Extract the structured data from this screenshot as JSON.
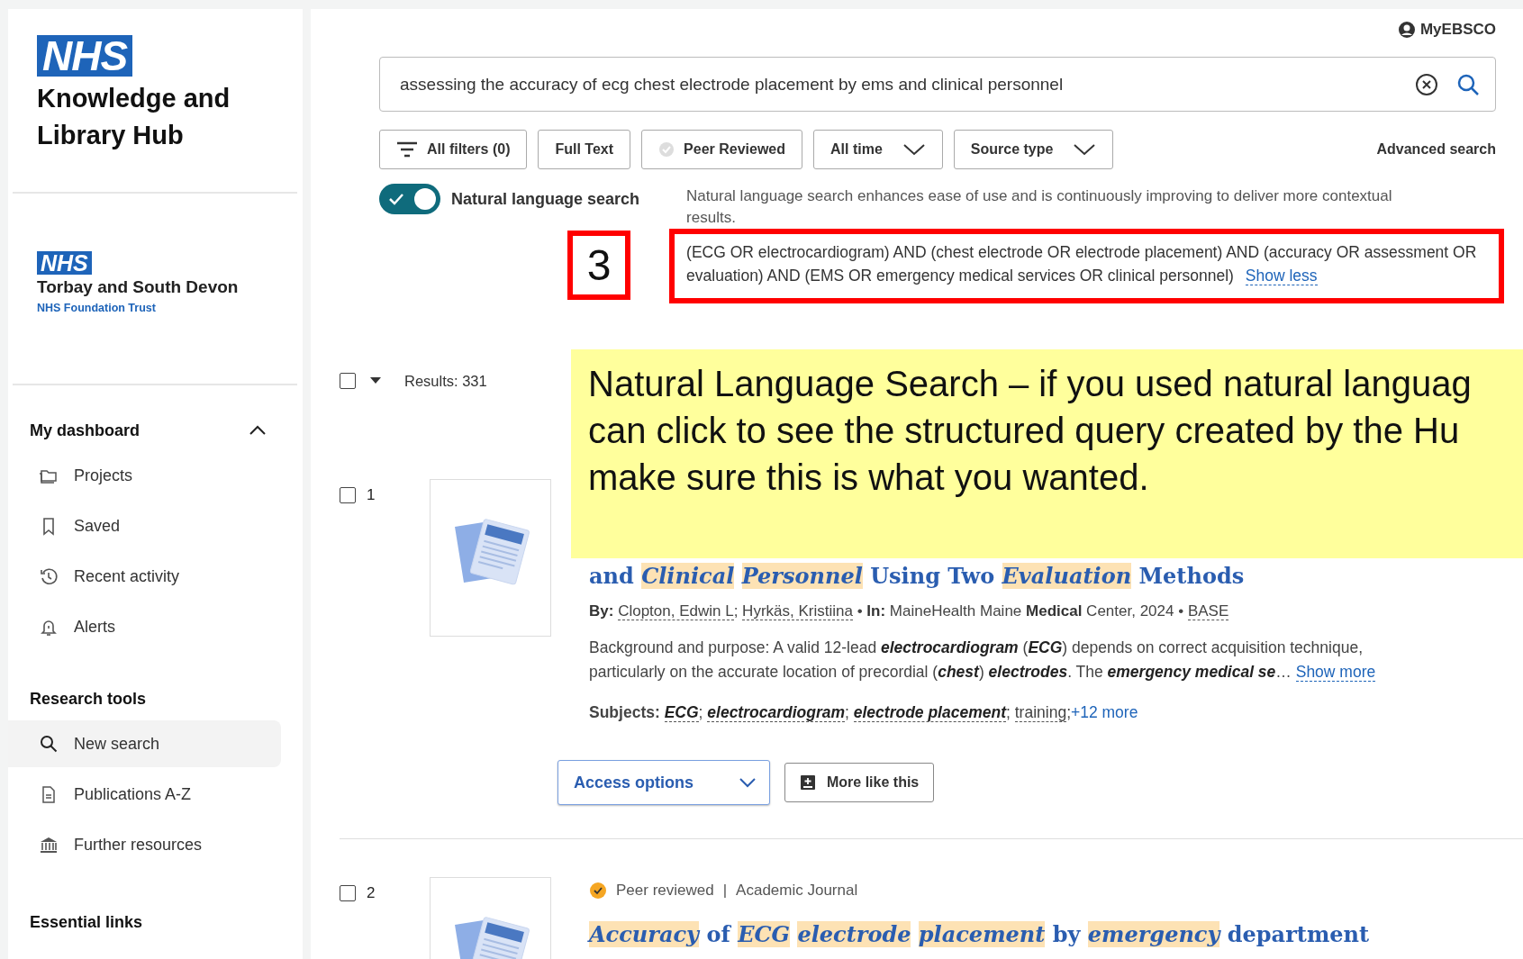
{
  "sidebar": {
    "logo": "NHS",
    "title": "Knowledge and Library Hub",
    "trust": {
      "logo": "NHS",
      "name": "Torbay and South Devon",
      "subtitle": "NHS Foundation Trust"
    },
    "sections": [
      {
        "heading": "My dashboard",
        "expanded": true,
        "items": [
          {
            "label": "Projects",
            "selected": false
          },
          {
            "label": "Saved",
            "selected": false
          },
          {
            "label": "Recent activity",
            "selected": false
          },
          {
            "label": "Alerts",
            "selected": false
          }
        ]
      },
      {
        "heading": "Research tools",
        "items": [
          {
            "label": "New search",
            "selected": true
          },
          {
            "label": "Publications A-Z",
            "selected": false
          },
          {
            "label": "Further resources",
            "selected": false
          }
        ]
      },
      {
        "heading": "Essential links"
      }
    ]
  },
  "account": {
    "label": "MyEBSCO"
  },
  "search": {
    "value": "assessing the accuracy of ecg chest electrode placement by ems and clinical personnel"
  },
  "filters": [
    {
      "label": "All filters (0)",
      "kind": "filters"
    },
    {
      "label": "Full Text",
      "kind": "plain"
    },
    {
      "label": "Peer Reviewed",
      "kind": "check",
      "checked": false
    },
    {
      "label": "All time",
      "kind": "dropdown"
    },
    {
      "label": "Source type",
      "kind": "dropdown"
    }
  ],
  "advanced_search": "Advanced search",
  "natural_language": {
    "label": "Natural language search",
    "on": true,
    "description": "Natural language search enhances ease of use and is continuously improving to deliver more contextual results.",
    "query": "(ECG OR electrocardiogram) AND (chest electrode OR electrode placement) AND (accuracy OR assessment OR evaluation) AND (EMS OR emergency medical services OR clinical personnel)",
    "toggle_link": "Show less"
  },
  "results_summary": {
    "label": "Results: 331",
    "checked": false
  },
  "results": [
    {
      "number": "1",
      "checked": false,
      "title": [
        {
          "text": "and",
          "highlighted": false
        },
        {
          "text": "Clinical",
          "highlighted": true
        },
        {
          "text": "Personnel",
          "highlighted": true
        },
        {
          "text": "Using Two",
          "highlighted": false
        },
        {
          "text": "Evaluation",
          "highlighted": true
        },
        {
          "text": "Methods",
          "highlighted": false
        }
      ],
      "byline": {
        "by_label": "By:",
        "authors": [
          "Clopton, Edwin L",
          "Hyrkäs, Kristiina"
        ],
        "author_separator": ";",
        "bullet": "•",
        "in_label": "In:",
        "source": "MaineHealth Maine **Medical** Center, 2024",
        "database": "BASE"
      },
      "abstract": {
        "text": "Background and purpose: A valid 12-lead **electrocardiogram** (**ECG**) depends on correct acquisition technique, particularly on the accurate location of precordial (**chest**) **electrodes**. The **emergency medical se**…",
        "more": "Show more"
      },
      "subjects": {
        "label": "Subjects:",
        "separator": ";",
        "items": [
          {
            "text": "ECG",
            "highlighted": true
          },
          {
            "text": "electrocardiogram",
            "highlighted": true
          },
          {
            "text": "electrode placement",
            "highlighted": true
          },
          {
            "text": "training",
            "highlighted": false
          }
        ],
        "more": "+12 more"
      },
      "actions": [
        {
          "label": "Access options",
          "kind": "dropdown"
        },
        {
          "label": "More like this",
          "kind": "more"
        }
      ]
    },
    {
      "number": "2",
      "checked": false,
      "badge": "Peer reviewed",
      "divider": "|",
      "source_type": "Academic Journal",
      "title": [
        {
          "text": "Accuracy",
          "highlighted": true
        },
        {
          "text": "of",
          "highlighted": false
        },
        {
          "text": "ECG",
          "highlighted": true
        },
        {
          "text": "electrode",
          "highlighted": true
        },
        {
          "text": "placement",
          "highlighted": true
        },
        {
          "text": "by",
          "highlighted": false
        },
        {
          "text": "emergency",
          "highlighted": true
        },
        {
          "text": "department",
          "highlighted": false
        }
      ]
    }
  ],
  "annotation": {
    "step": "3",
    "callout": [
      "Natural Language Search – if you used natural languag",
      "can click to see the structured query created by the Hu",
      "make sure this is what you wanted."
    ]
  }
}
